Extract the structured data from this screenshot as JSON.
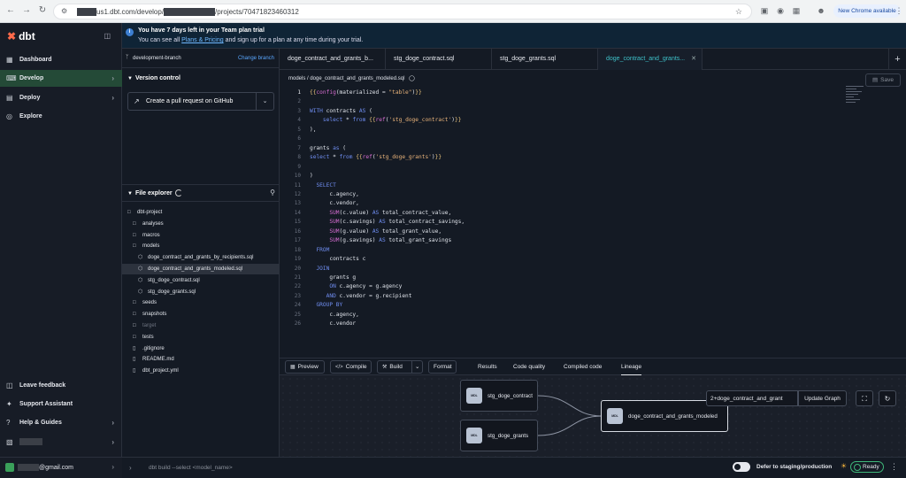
{
  "browser": {
    "url_visible": "us1.dbt.com/develop/",
    "url_suffix": "/projects/70471823460312",
    "new_chrome": "New Chrome available",
    "icons": [
      "back-icon",
      "forward-icon",
      "reload-icon",
      "site-settings-icon",
      "bookmark-star-icon",
      "extension-icon",
      "camera-icon",
      "puzzle-icon",
      "avatar-icon",
      "menu-dots-icon"
    ]
  },
  "sidebar": {
    "logo": "dbt",
    "nav": [
      {
        "label": "Dashboard",
        "icon": "dashboard-icon"
      },
      {
        "label": "Develop",
        "icon": "code-icon",
        "active": true
      },
      {
        "label": "Deploy",
        "icon": "deploy-icon"
      },
      {
        "label": "Explore",
        "icon": "compass-icon"
      }
    ],
    "bottom_nav": [
      {
        "label": "Leave feedback",
        "icon": "feedback-icon"
      },
      {
        "label": "Support Assistant",
        "icon": "assistant-icon"
      },
      {
        "label": "Help & Guides",
        "icon": "help-icon"
      }
    ],
    "account_email_suffix": "@gmail.com"
  },
  "banner": {
    "title": "You have 7 days left in your Team plan trial",
    "line_prefix": "You can see all ",
    "link": "Plans & Pricing",
    "line_suffix": " and sign up for a plan at any time during your trial."
  },
  "left_panel": {
    "branch": "development-branch",
    "change_branch": "Change branch",
    "version_control": "Version control",
    "pr_button": "Create a pull request on GitHub",
    "file_explorer": "File explorer",
    "tree": [
      {
        "label": "dbt-project",
        "type": "folder",
        "depth": 0
      },
      {
        "label": "analyses",
        "type": "folder",
        "depth": 1
      },
      {
        "label": "macros",
        "type": "folder",
        "depth": 1
      },
      {
        "label": "models",
        "type": "folder",
        "depth": 1
      },
      {
        "label": "doge_contract_and_grants_by_recipients.sql",
        "type": "model",
        "depth": 2
      },
      {
        "label": "doge_contract_and_grants_modeled.sql",
        "type": "model",
        "depth": 2,
        "selected": true
      },
      {
        "label": "stg_doge_contract.sql",
        "type": "model",
        "depth": 2
      },
      {
        "label": "stg_doge_grants.sql",
        "type": "model",
        "depth": 2
      },
      {
        "label": "seeds",
        "type": "folder",
        "depth": 1
      },
      {
        "label": "snapshots",
        "type": "folder",
        "depth": 1
      },
      {
        "label": "target",
        "type": "folder",
        "depth": 1,
        "dim": true
      },
      {
        "label": "tests",
        "type": "folder",
        "depth": 1
      },
      {
        "label": ".gitignore",
        "type": "file",
        "depth": 1
      },
      {
        "label": "README.md",
        "type": "file",
        "depth": 1
      },
      {
        "label": "dbt_project.yml",
        "type": "file",
        "depth": 1
      }
    ]
  },
  "editor": {
    "tabs": [
      {
        "label": "doge_contract_and_grants_b..."
      },
      {
        "label": "stg_doge_contract.sql"
      },
      {
        "label": "stg_doge_grants.sql"
      },
      {
        "label": "doge_contract_and_grants...",
        "active": true
      }
    ],
    "breadcrumb": "models / doge_contract_and_grants_modeled.sql",
    "save": "Save",
    "lines": [
      "{{config(materialized = \"table\")}}",
      "",
      "WITH contracts AS (",
      "    select * from {{ref('stg_doge_contract')}}",
      "),",
      "",
      "grants as (",
      "select * from {{ref('stg_doge_grants')}}",
      "",
      ")",
      "  SELECT",
      "      c.agency,",
      "      c.vendor,",
      "      SUM(c.value) AS total_contract_value,",
      "      SUM(c.savings) AS total_contract_savings,",
      "      SUM(g.value) AS total_grant_value,",
      "      SUM(g.savings) AS total_grant_savings",
      "  FROM",
      "      contracts c",
      "  JOIN",
      "      grants g",
      "      ON c.agency = g.agency",
      "     AND c.vendor = g.recipient",
      "  GROUP BY",
      "      c.agency,",
      "      c.vendor"
    ]
  },
  "toolbar": {
    "preview": "Preview",
    "compile": "Compile",
    "build": "Build",
    "format": "Format",
    "tabs": [
      "Results",
      "Code quality",
      "Compiled code",
      "Lineage"
    ],
    "active_tab": "Lineage"
  },
  "lineage": {
    "nodes": [
      {
        "name": "stg_doge_contract"
      },
      {
        "name": "stg_doge_grants"
      },
      {
        "name": "doge_contract_and_grants_modeled"
      }
    ],
    "badge": "MDL",
    "selector": "2+doge_contract_and_grant",
    "update_graph": "Update Graph"
  },
  "status": {
    "command_placeholder": "dbt build --select <model_name>",
    "defer": "Defer to staging/production",
    "ready": "Ready"
  },
  "colors": {
    "accent_green": "#3fb87a",
    "link_blue": "#5aa7ff",
    "active_tab": "#3ec1c9",
    "dbt_orange": "#ff694a"
  }
}
